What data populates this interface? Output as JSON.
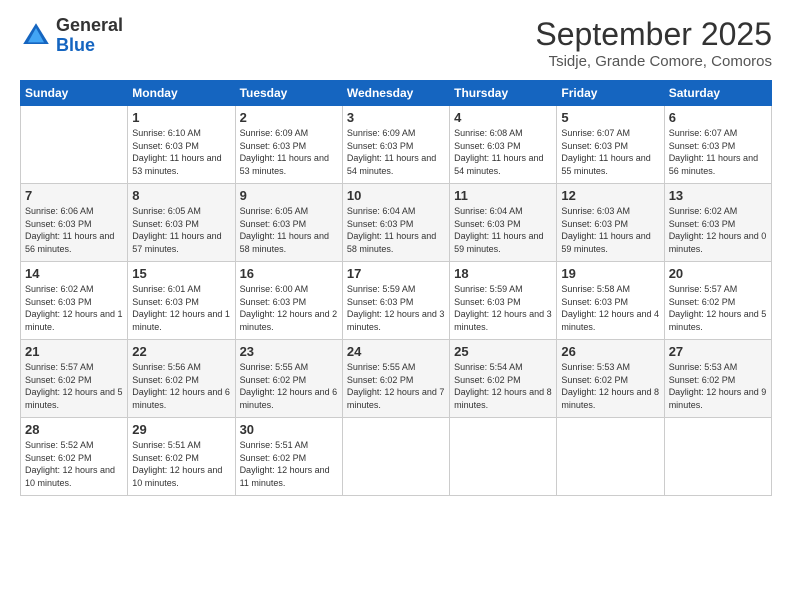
{
  "logo": {
    "general": "General",
    "blue": "Blue"
  },
  "title": "September 2025",
  "subtitle": "Tsidje, Grande Comore, Comoros",
  "days_of_week": [
    "Sunday",
    "Monday",
    "Tuesday",
    "Wednesday",
    "Thursday",
    "Friday",
    "Saturday"
  ],
  "weeks": [
    [
      {
        "day": "",
        "info": ""
      },
      {
        "day": "1",
        "info": "Sunrise: 6:10 AM\nSunset: 6:03 PM\nDaylight: 11 hours\nand 53 minutes."
      },
      {
        "day": "2",
        "info": "Sunrise: 6:09 AM\nSunset: 6:03 PM\nDaylight: 11 hours\nand 53 minutes."
      },
      {
        "day": "3",
        "info": "Sunrise: 6:09 AM\nSunset: 6:03 PM\nDaylight: 11 hours\nand 54 minutes."
      },
      {
        "day": "4",
        "info": "Sunrise: 6:08 AM\nSunset: 6:03 PM\nDaylight: 11 hours\nand 54 minutes."
      },
      {
        "day": "5",
        "info": "Sunrise: 6:07 AM\nSunset: 6:03 PM\nDaylight: 11 hours\nand 55 minutes."
      },
      {
        "day": "6",
        "info": "Sunrise: 6:07 AM\nSunset: 6:03 PM\nDaylight: 11 hours\nand 56 minutes."
      }
    ],
    [
      {
        "day": "7",
        "info": "Sunrise: 6:06 AM\nSunset: 6:03 PM\nDaylight: 11 hours\nand 56 minutes."
      },
      {
        "day": "8",
        "info": "Sunrise: 6:05 AM\nSunset: 6:03 PM\nDaylight: 11 hours\nand 57 minutes."
      },
      {
        "day": "9",
        "info": "Sunrise: 6:05 AM\nSunset: 6:03 PM\nDaylight: 11 hours\nand 58 minutes."
      },
      {
        "day": "10",
        "info": "Sunrise: 6:04 AM\nSunset: 6:03 PM\nDaylight: 11 hours\nand 58 minutes."
      },
      {
        "day": "11",
        "info": "Sunrise: 6:04 AM\nSunset: 6:03 PM\nDaylight: 11 hours\nand 59 minutes."
      },
      {
        "day": "12",
        "info": "Sunrise: 6:03 AM\nSunset: 6:03 PM\nDaylight: 11 hours\nand 59 minutes."
      },
      {
        "day": "13",
        "info": "Sunrise: 6:02 AM\nSunset: 6:03 PM\nDaylight: 12 hours\nand 0 minutes."
      }
    ],
    [
      {
        "day": "14",
        "info": "Sunrise: 6:02 AM\nSunset: 6:03 PM\nDaylight: 12 hours\nand 1 minute."
      },
      {
        "day": "15",
        "info": "Sunrise: 6:01 AM\nSunset: 6:03 PM\nDaylight: 12 hours\nand 1 minute."
      },
      {
        "day": "16",
        "info": "Sunrise: 6:00 AM\nSunset: 6:03 PM\nDaylight: 12 hours\nand 2 minutes."
      },
      {
        "day": "17",
        "info": "Sunrise: 5:59 AM\nSunset: 6:03 PM\nDaylight: 12 hours\nand 3 minutes."
      },
      {
        "day": "18",
        "info": "Sunrise: 5:59 AM\nSunset: 6:03 PM\nDaylight: 12 hours\nand 3 minutes."
      },
      {
        "day": "19",
        "info": "Sunrise: 5:58 AM\nSunset: 6:03 PM\nDaylight: 12 hours\nand 4 minutes."
      },
      {
        "day": "20",
        "info": "Sunrise: 5:57 AM\nSunset: 6:02 PM\nDaylight: 12 hours\nand 5 minutes."
      }
    ],
    [
      {
        "day": "21",
        "info": "Sunrise: 5:57 AM\nSunset: 6:02 PM\nDaylight: 12 hours\nand 5 minutes."
      },
      {
        "day": "22",
        "info": "Sunrise: 5:56 AM\nSunset: 6:02 PM\nDaylight: 12 hours\nand 6 minutes."
      },
      {
        "day": "23",
        "info": "Sunrise: 5:55 AM\nSunset: 6:02 PM\nDaylight: 12 hours\nand 6 minutes."
      },
      {
        "day": "24",
        "info": "Sunrise: 5:55 AM\nSunset: 6:02 PM\nDaylight: 12 hours\nand 7 minutes."
      },
      {
        "day": "25",
        "info": "Sunrise: 5:54 AM\nSunset: 6:02 PM\nDaylight: 12 hours\nand 8 minutes."
      },
      {
        "day": "26",
        "info": "Sunrise: 5:53 AM\nSunset: 6:02 PM\nDaylight: 12 hours\nand 8 minutes."
      },
      {
        "day": "27",
        "info": "Sunrise: 5:53 AM\nSunset: 6:02 PM\nDaylight: 12 hours\nand 9 minutes."
      }
    ],
    [
      {
        "day": "28",
        "info": "Sunrise: 5:52 AM\nSunset: 6:02 PM\nDaylight: 12 hours\nand 10 minutes."
      },
      {
        "day": "29",
        "info": "Sunrise: 5:51 AM\nSunset: 6:02 PM\nDaylight: 12 hours\nand 10 minutes."
      },
      {
        "day": "30",
        "info": "Sunrise: 5:51 AM\nSunset: 6:02 PM\nDaylight: 12 hours\nand 11 minutes."
      },
      {
        "day": "",
        "info": ""
      },
      {
        "day": "",
        "info": ""
      },
      {
        "day": "",
        "info": ""
      },
      {
        "day": "",
        "info": ""
      }
    ]
  ]
}
